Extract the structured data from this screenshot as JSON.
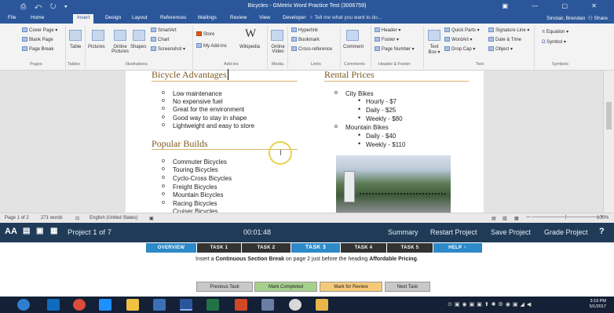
{
  "window": {
    "title": "Bicycles - GMetrix Word Practice Test (3006759)",
    "quick_access": "⎙ ↶ ↻ ▾",
    "controls": "▣ — ▢ ✕"
  },
  "tabs": [
    "File",
    "Home",
    "Insert",
    "Design",
    "Layout",
    "References",
    "Mailings",
    "Review",
    "View",
    "Developer"
  ],
  "tell_me": "Tell me what you want to do...",
  "user": "Sinclair, Brendan",
  "share": "Share",
  "ribbon": {
    "pages": [
      "Cover Page ▾",
      "Blank Page",
      "Page Break"
    ],
    "table": "Table",
    "pictures": "Pictures",
    "online_pictures": "Online Pictures",
    "shapes": "Shapes",
    "smartart": "SmartArt",
    "chart": "Chart",
    "screenshot": "Screenshot ▾",
    "store": "Store",
    "my_addins": "My Add-ins",
    "wikipedia": "Wikipedia",
    "online_video": "Online Video",
    "links": [
      "Hyperlink",
      "Bookmark",
      "Cross-reference"
    ],
    "comment": "Comment",
    "header_footer": [
      "Header ▾",
      "Footer ▾",
      "Page Number ▾"
    ],
    "text_box": "Text Box ▾",
    "text_items": [
      "Quick Parts ▾",
      "WordArt ▾",
      "Drop Cap ▾"
    ],
    "text_items2": [
      "Signature Line ▾",
      "Date & Time",
      "Object ▾"
    ],
    "symbols": [
      "Equation ▾",
      "Symbol ▾"
    ],
    "groups": [
      "Pages",
      "Tables",
      "Illustrations",
      "Add-ins",
      "Media",
      "Links",
      "Comments",
      "Header & Footer",
      "Text",
      "Symbols"
    ]
  },
  "document": {
    "advantages_heading": "Bicycle Advantages",
    "advantages": [
      "Low maintenance",
      "No expensive fuel",
      "Great for the environment",
      "Good way to stay in shape",
      "Lightweight and easy to store"
    ],
    "builds_heading": "Popular Builds",
    "builds": [
      "Commuter Bicycles",
      "Touring Bicycles",
      "Cyclo-Cross Bicycles",
      "Freight Bicycles",
      "Mountain Bicycles",
      "Racing Bicycles",
      "Cruiser Bicycles"
    ],
    "prices_heading": "Rental Prices",
    "city_bikes": "City Bikes",
    "city_prices": [
      "Hourly - $7",
      "Daily - $25",
      "Weekly - $80"
    ],
    "mountain_bikes": "Mountain Bikes",
    "mountain_prices": [
      "Daily - $40",
      "Weekly - $110"
    ]
  },
  "status": {
    "page": "Page 1 of 2",
    "words": "271 words",
    "language": "English (United States)",
    "zoom": "100%"
  },
  "gmetrix": {
    "logo": "AA",
    "project": "Project 1 of 7",
    "timer": "00:01:48",
    "summary": "Summary",
    "restart": "Restart Project",
    "save": "Save Project",
    "grade": "Grade Project",
    "help_q": "?"
  },
  "task_tabs": [
    "OVERVIEW",
    "TASK 1",
    "TASK 2",
    "TASK 3",
    "TASK 4",
    "TASK 5",
    "HELP"
  ],
  "instruction": {
    "pre": "Insert a ",
    "bold1": "Continuous Section Break",
    "mid": " on page 2 just before the heading ",
    "bold2": "Affordable Pricing",
    "post": "."
  },
  "buttons": {
    "previous": "Previous Task",
    "completed": "Mark Completed",
    "review": "Mark for Review",
    "next": "Next Task"
  },
  "taskbar": {
    "time": "3:19 PM",
    "date": "5/1/2017"
  }
}
